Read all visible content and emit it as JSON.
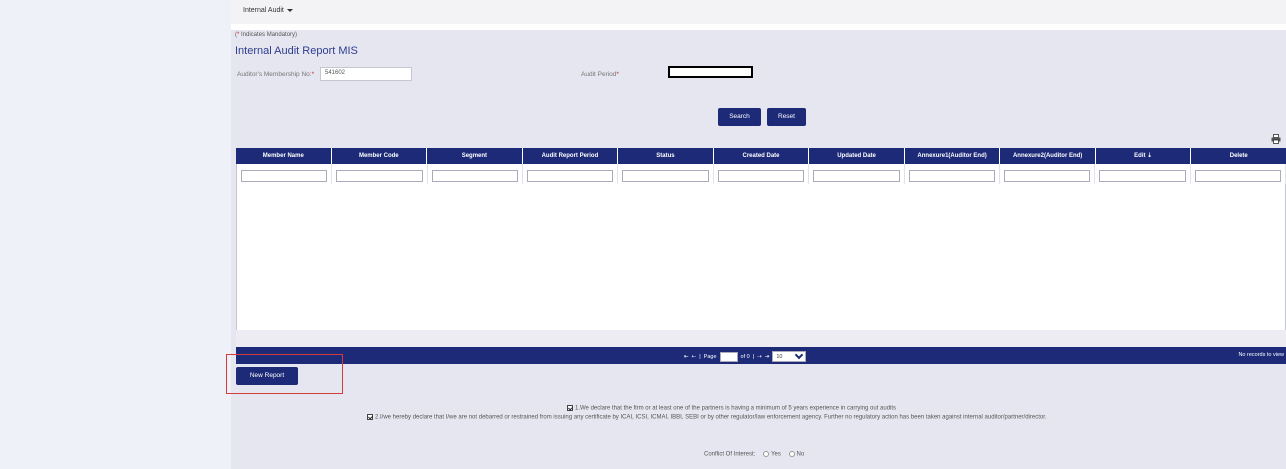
{
  "nav": {
    "menu_label": "Internal Audit"
  },
  "form": {
    "mandatory_star": "*",
    "mandatory_text": " Indicates Mandatory)",
    "mandatory_open": "(",
    "title": "Internal Audit Report MIS",
    "membership_label": "Auditor's Membership No:",
    "membership_value": "541602",
    "period_label": "Audit Period",
    "required_star": "*",
    "search_label": "Search",
    "reset_label": "Reset"
  },
  "grid": {
    "columns": [
      "Member Name",
      "Member Code",
      "Segment",
      "Audit Report Period",
      "Status",
      "Created Date",
      "Updated Date",
      "Annexure1(Auditor End)",
      "Annexure2(Auditor End)",
      "Edit ⇣",
      "Delete"
    ],
    "pager": {
      "first": "⇤",
      "prev": "⇠",
      "page_label": "Page",
      "of_label": "of 0",
      "next": "⇢",
      "last": "⇥",
      "page_size": "10",
      "no_records": "No records to view"
    }
  },
  "actions": {
    "new_report_label": "New Report"
  },
  "declarations": {
    "d1": "1.We declare that the firm or at least one of the partners is having a minimum of 5 years experience in carrying out audits",
    "d2": "2.I/we hereby declare that I/we are not debarred or restrained from issuing any certificate by ICAI, ICSI, ICMAI, IBBI, SEBI or by other regulator/law enforcement agency. Further no regulatory action has been taken against internal auditor/partner/director."
  },
  "conflict": {
    "label": "Conflict Of Interest:",
    "yes": "Yes",
    "no": "No"
  },
  "colors": {
    "primary": "#1c2a78",
    "panel": "#e6e6f0",
    "required": "#d21f1f",
    "highlight": "#d43b3b"
  }
}
